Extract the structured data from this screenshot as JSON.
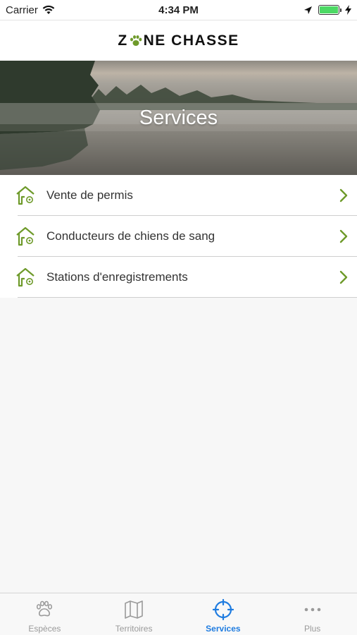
{
  "status_bar": {
    "carrier": "Carrier",
    "time": "4:34 PM"
  },
  "header": {
    "logo_part1": "Z",
    "logo_part2": "NE CHASSE"
  },
  "hero": {
    "title": "Services"
  },
  "services": [
    {
      "label": "Vente de permis",
      "icon": "house-icon"
    },
    {
      "label": "Conducteurs de chiens de sang",
      "icon": "house-icon"
    },
    {
      "label": "Stations d'enregistrements",
      "icon": "house-icon"
    }
  ],
  "tab_bar": {
    "tabs": [
      {
        "label": "Espèces",
        "icon": "paw-icon",
        "active": false
      },
      {
        "label": "Territoires",
        "icon": "map-icon",
        "active": false
      },
      {
        "label": "Services",
        "icon": "crosshair-icon",
        "active": true
      },
      {
        "label": "Plus",
        "icon": "more-icon",
        "active": false
      }
    ]
  },
  "colors": {
    "accent_green": "#6e9a2a",
    "active_tab_blue": "#1f7ce0",
    "battery_green": "#4cd964"
  }
}
